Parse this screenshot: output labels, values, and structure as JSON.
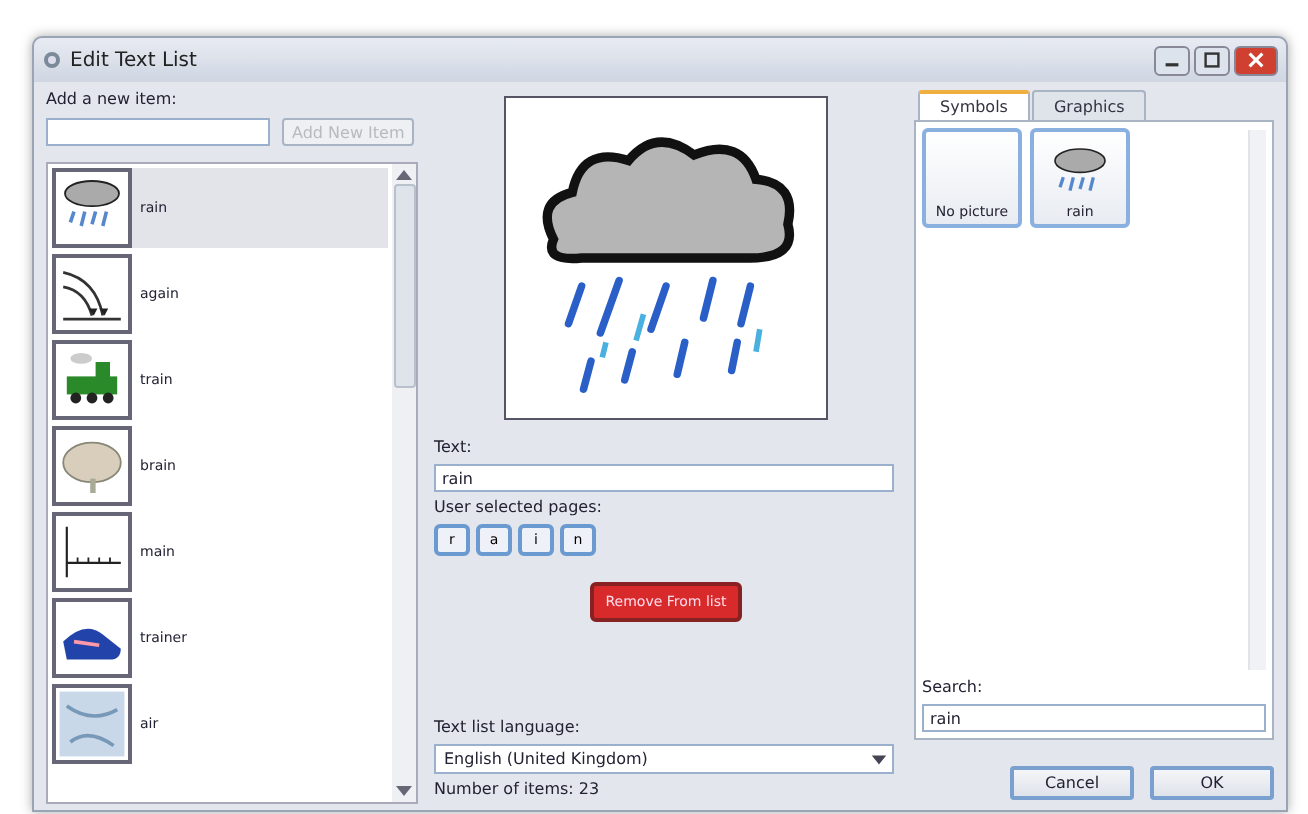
{
  "window": {
    "title": "Edit Text List"
  },
  "add_item": {
    "label": "Add a new item:",
    "button": "Add New Item"
  },
  "items": [
    {
      "label": "rain",
      "kind": "cloud",
      "selected": true
    },
    {
      "label": "again",
      "kind": "path",
      "selected": false
    },
    {
      "label": "train",
      "kind": "train",
      "selected": false
    },
    {
      "label": "brain",
      "kind": "brain",
      "selected": false
    },
    {
      "label": "main",
      "kind": "line",
      "selected": false
    },
    {
      "label": "trainer",
      "kind": "shoe",
      "selected": false
    },
    {
      "label": "air",
      "kind": "map",
      "selected": false
    }
  ],
  "editor": {
    "text_label": "Text:",
    "text_value": "rain",
    "pages_label": "User selected pages:",
    "pages": [
      "r",
      "a",
      "i",
      "n"
    ],
    "remove_button": "Remove From list",
    "language_label": "Text list language:",
    "language": "English (United Kingdom)",
    "count": "Number of items: 23"
  },
  "tabs": [
    {
      "label": "Symbols",
      "selected": true
    },
    {
      "label": "Graphics",
      "selected": false
    }
  ],
  "symbols": [
    {
      "label": "No picture",
      "kind": "empty"
    },
    {
      "label": "rain",
      "kind": "cloud"
    }
  ],
  "search": {
    "label": "Search:",
    "value": "rain"
  },
  "buttons": [
    "Cancel",
    "OK"
  ]
}
